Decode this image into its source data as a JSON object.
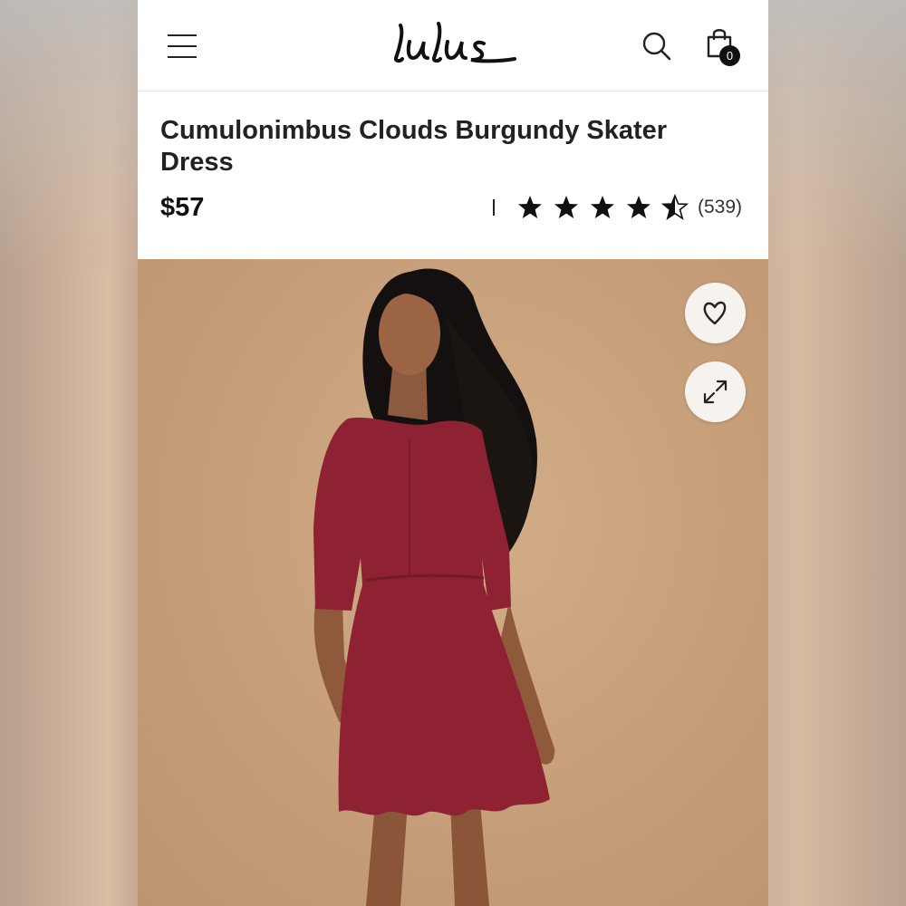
{
  "header": {
    "logo_text": "Lulus",
    "cart_count": "0",
    "icons": [
      "menu-icon",
      "search-icon",
      "shopping-bag-icon"
    ]
  },
  "product": {
    "title": "Cumulonimbus Clouds Burgundy Skater Dress",
    "price": "$57",
    "rating_value": 4.5,
    "rating_max": 5,
    "review_count": "(539)"
  },
  "image_actions": {
    "icons": [
      "heart-icon",
      "expand-icon"
    ]
  },
  "colors": {
    "dress": "#8e2233",
    "background": "#c8a17c",
    "text": "#222222",
    "badge": "#111111"
  }
}
